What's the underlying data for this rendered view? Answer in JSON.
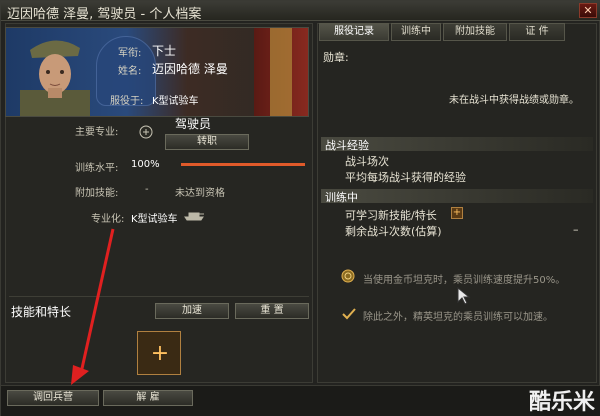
{
  "window": {
    "title": "迈因哈德 泽曼, 驾驶员 - 个人档案",
    "close_label": "✕"
  },
  "profile": {
    "rank_label": "军衔:",
    "rank_value": "下士",
    "name_label": "姓名:",
    "name_value": "迈因哈德 泽曼",
    "serves_label": "服役于:",
    "serves_value": "K型试验车"
  },
  "details": {
    "specialty_label": "主要专业:",
    "specialty_value": "驾驶员",
    "retrain_button": "转职",
    "training_label": "训练水平:",
    "training_value": "100%",
    "training_progress": 1.0,
    "extra_skill_label": "附加技能:",
    "extra_skill_dash": "-",
    "extra_skill_value": "未达到资格",
    "specialization_label": "专业化:",
    "specialization_value": "K型试验车"
  },
  "skills": {
    "title": "技能和特长",
    "accelerate_button": "加速",
    "reset_button": "重 置",
    "add_symbol": "+"
  },
  "tabs": [
    {
      "label": "服役记录",
      "active": true
    },
    {
      "label": "训练中",
      "active": false
    },
    {
      "label": "附加技能",
      "active": false
    },
    {
      "label": "证 件",
      "active": false
    }
  ],
  "record": {
    "medals_title": "勋章:",
    "medals_empty": "未在战斗中获得战绩或勋章。",
    "battle_title": "战斗经验",
    "battle_count": "战斗场次",
    "battle_avg_xp": "平均每场战斗获得的经验",
    "training_title": "训练中",
    "new_skill": "可学习新技能/特长",
    "new_skill_plus": "+",
    "remaining_battles": "剩余战斗次数(估算)",
    "remaining_value": "–",
    "gold_tank_note": "当使用金币坦克时，乘员训练速度提升50%。",
    "elite_note": "除此之外，精英坦克的乘员训练可以加速。"
  },
  "footer": {
    "return_button": "调回兵营",
    "dismiss_button": "解 雇",
    "watermark": "酷乐米"
  },
  "colors": {
    "progress": "#e05a2a",
    "accent_gold": "#b08040",
    "arrow_red": "#e02020"
  }
}
